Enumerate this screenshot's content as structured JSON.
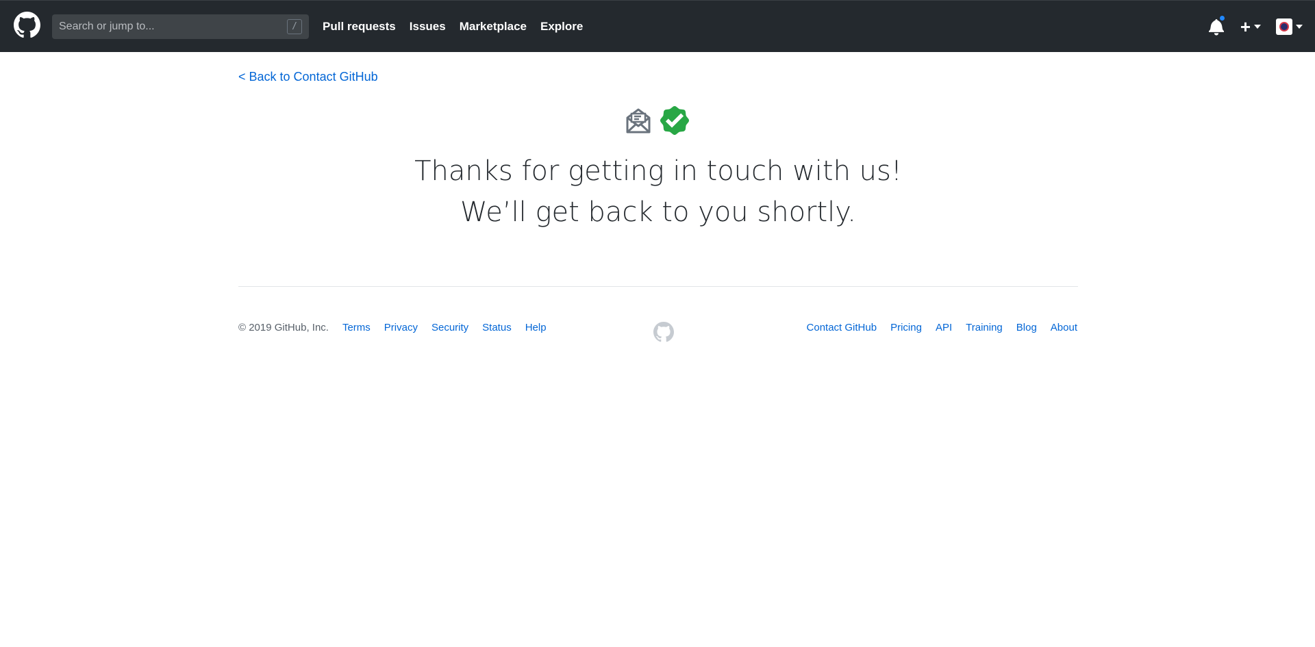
{
  "header": {
    "search": {
      "placeholder": "Search or jump to...",
      "shortcut_key": "/"
    },
    "nav": [
      {
        "label": "Pull requests"
      },
      {
        "label": "Issues"
      },
      {
        "label": "Marketplace"
      },
      {
        "label": "Explore"
      }
    ],
    "icons": {
      "logo": "github-octocat-icon",
      "notifications": "bell-icon",
      "create": "plus-icon",
      "avatar": "avatar-icon"
    },
    "colors": {
      "background": "#24292e",
      "notification_dot": "#2188ff"
    }
  },
  "main": {
    "back_link": "< Back to Contact GitHub",
    "icons": {
      "mail": "open-envelope-icon",
      "verified": "verified-check-icon"
    },
    "message_line1": "Thanks for getting in touch with us!",
    "message_line2": "We’ll get back to you shortly.",
    "colors": {
      "link": "#0366d6",
      "verified": "#28a745",
      "mail_icon": "#6a737d"
    }
  },
  "footer": {
    "copyright": "© 2019 GitHub, Inc.",
    "left_links": [
      {
        "label": "Terms"
      },
      {
        "label": "Privacy"
      },
      {
        "label": "Security"
      },
      {
        "label": "Status"
      },
      {
        "label": "Help"
      }
    ],
    "mark_icon": "github-mark-icon",
    "right_links": [
      {
        "label": "Contact GitHub"
      },
      {
        "label": "Pricing"
      },
      {
        "label": "API"
      },
      {
        "label": "Training"
      },
      {
        "label": "Blog"
      },
      {
        "label": "About"
      }
    ]
  }
}
